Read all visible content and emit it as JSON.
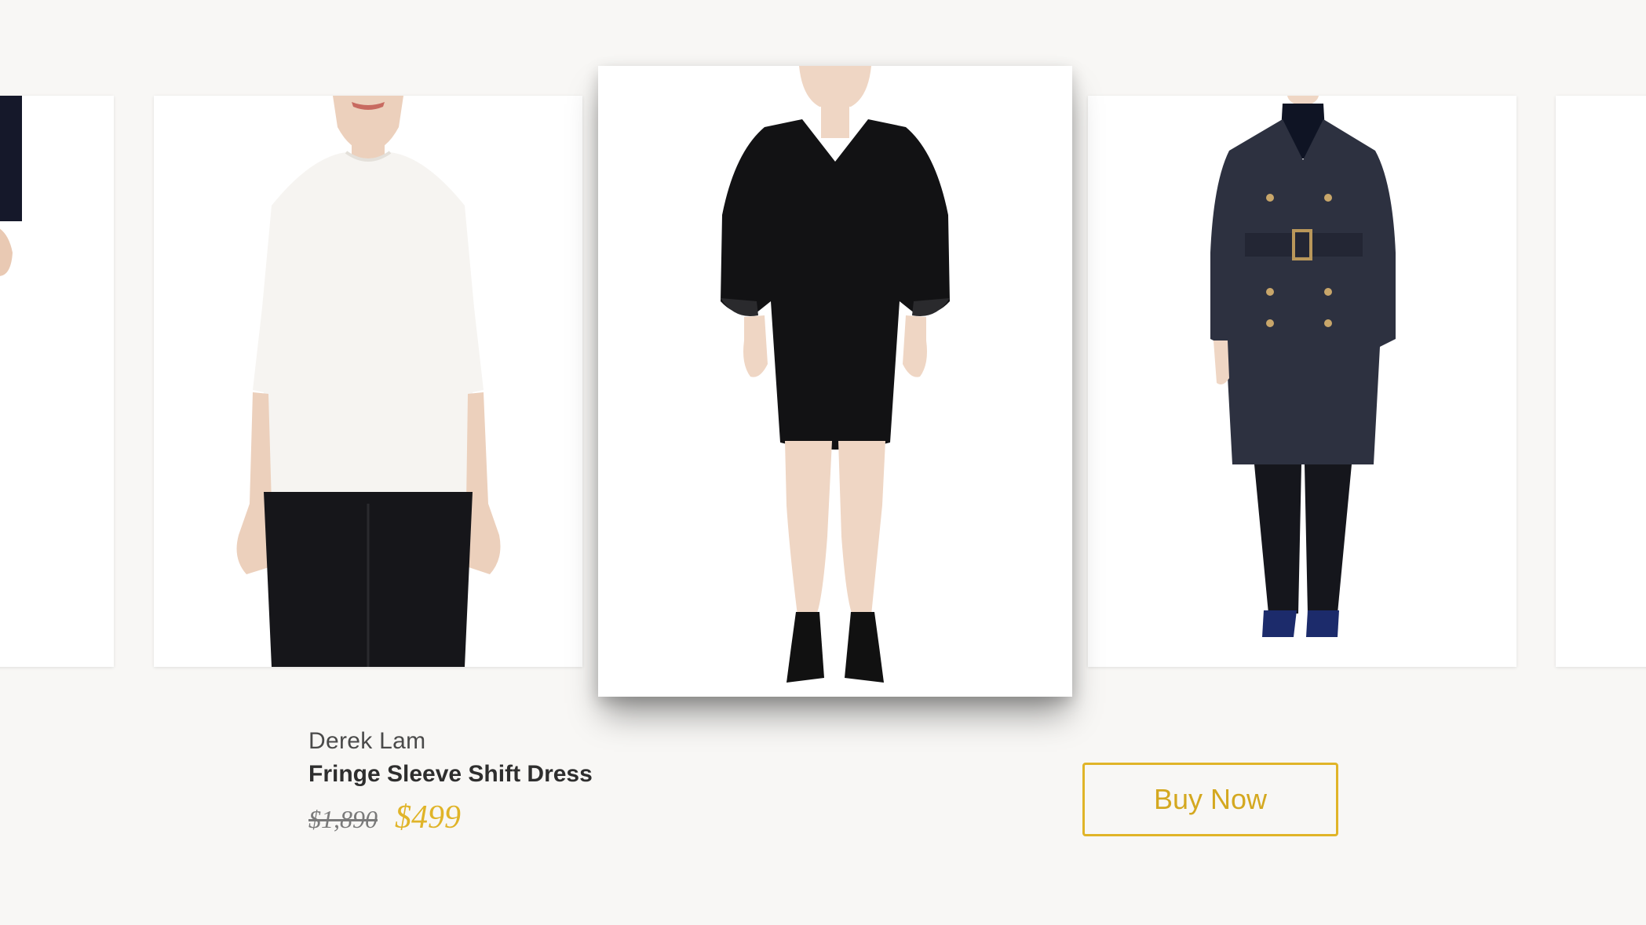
{
  "carousel": {
    "items": [
      {
        "name": "partial-product-left",
        "image": "model-in-dark-outfit"
      },
      {
        "name": "white-sweater",
        "image": "model-in-white-sweater-black-pants"
      },
      {
        "name": "fringe-sleeve-shift-dress",
        "image": "model-in-black-shift-dress",
        "focused": true
      },
      {
        "name": "trench-coat",
        "image": "model-in-navy-trench-coat"
      },
      {
        "name": "partial-product-right",
        "image": "blank-product-card"
      }
    ]
  },
  "product": {
    "brand": "Derek Lam",
    "name": "Fringe Sleeve Shift Dress",
    "original_price": "$1,890",
    "sale_price": "$499"
  },
  "actions": {
    "buy_label": "Buy Now"
  },
  "colors": {
    "background": "#f8f7f5",
    "accent_gold": "#e0b428",
    "text_dark": "#2e2e2e",
    "text_muted": "#7a7a7a"
  }
}
